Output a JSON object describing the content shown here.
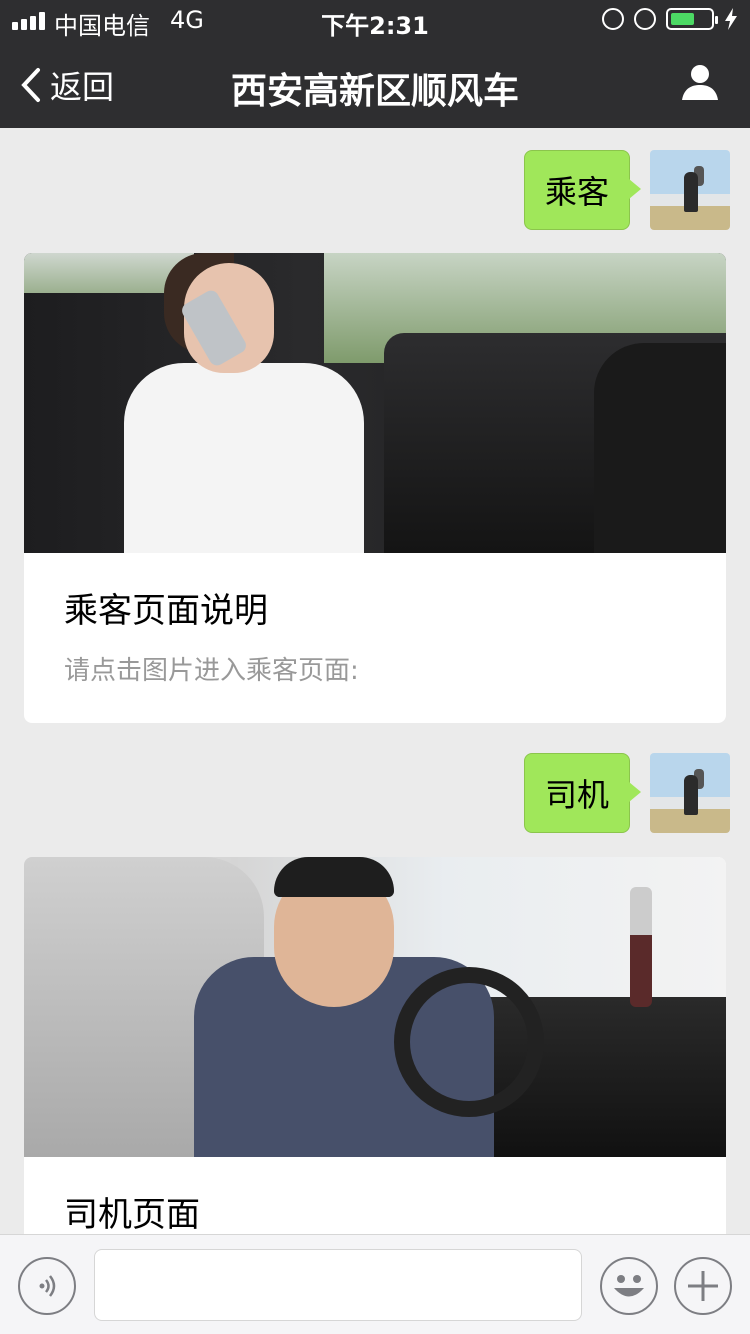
{
  "status_bar": {
    "carrier": "中国电信",
    "network": "4G",
    "time": "下午2:31",
    "battery_level": 0.55,
    "battery_color": "#4cd964"
  },
  "nav": {
    "back_label": "返回",
    "title": "西安高新区顺风车",
    "profile_icon": "user-icon"
  },
  "messages": [
    {
      "type": "outgoing",
      "text": "乘客"
    },
    {
      "type": "card",
      "title": "乘客页面说明",
      "description": "请点击图片进入乘客页面:"
    },
    {
      "type": "outgoing",
      "text": "司机"
    },
    {
      "type": "card",
      "title": "司机页面",
      "description": ""
    }
  ],
  "input_bar": {
    "voice_icon": "voice-icon",
    "text_value": "",
    "emoji_icon": "emoji-icon",
    "plus_icon": "plus-icon"
  },
  "colors": {
    "nav_bg": "#2e2e30",
    "chat_bg": "#ebebeb",
    "bubble_bg": "#a0e75a"
  }
}
